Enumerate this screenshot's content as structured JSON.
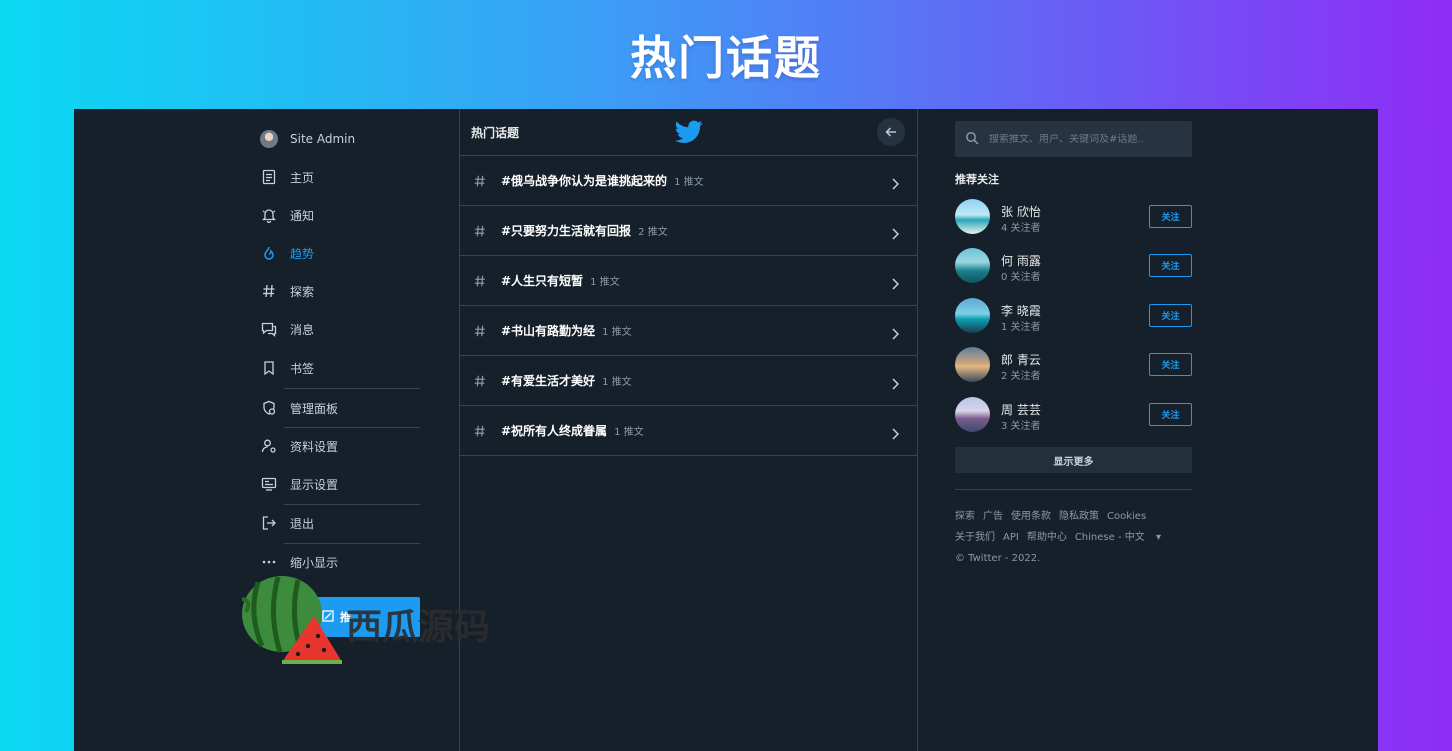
{
  "banner": {
    "title": "热门话题"
  },
  "nav": {
    "user": {
      "name": "Site Admin"
    },
    "items": [
      {
        "label": "主页",
        "icon": "home-icon"
      },
      {
        "label": "通知",
        "icon": "bell-icon"
      },
      {
        "label": "趋势",
        "icon": "flame-icon",
        "active": true
      },
      {
        "label": "探索",
        "icon": "hashtag-icon"
      },
      {
        "label": "消息",
        "icon": "messages-icon"
      },
      {
        "label": "书签",
        "icon": "bookmark-icon"
      },
      {
        "label": "管理面板",
        "icon": "admin-panel-icon"
      },
      {
        "label": "资料设置",
        "icon": "profile-settings-icon"
      },
      {
        "label": "显示设置",
        "icon": "display-settings-icon"
      },
      {
        "label": "退出",
        "icon": "logout-icon"
      },
      {
        "label": "缩小显示",
        "icon": "more-dots-icon"
      }
    ],
    "tweet_button": {
      "label": "推"
    }
  },
  "center": {
    "title": "热门话题",
    "topics": [
      {
        "name": "#俄乌战争你认为是谁挑起来的",
        "count": "1 推文"
      },
      {
        "name": "#只要努力生活就有回报",
        "count": "2 推文"
      },
      {
        "name": "#人生只有短暂",
        "count": "1 推文"
      },
      {
        "name": "#书山有路勤为经",
        "count": "1 推文"
      },
      {
        "name": "#有爱生活才美好",
        "count": "1 推文"
      },
      {
        "name": "#祝所有人终成眷属",
        "count": "1 推文"
      }
    ]
  },
  "right": {
    "search": {
      "placeholder": "搜索推文、用户、关键词及#话题.."
    },
    "suggest_title": "推荐关注",
    "users": [
      {
        "name": "张 欣怡",
        "followers": "4 关注者",
        "follow": "关注"
      },
      {
        "name": "何 雨露",
        "followers": "0 关注者",
        "follow": "关注"
      },
      {
        "name": "李 晓霞",
        "followers": "1 关注者",
        "follow": "关注"
      },
      {
        "name": "郎 青云",
        "followers": "2 关注者",
        "follow": "关注"
      },
      {
        "name": "周 芸芸",
        "followers": "3 关注者",
        "follow": "关注"
      }
    ],
    "show_more": "显示更多",
    "footer": {
      "links_row1": [
        "探索",
        "广告",
        "使用条款",
        "隐私政策",
        "Cookies"
      ],
      "links_row2": [
        "关于我们",
        "API",
        "帮助中心",
        "Chinese - 中文"
      ],
      "copyright": "© Twitter - 2022."
    }
  },
  "watermark": {
    "text": "西瓜源码"
  },
  "colors": {
    "accent": "#1d9bf0",
    "bg": "#15202b",
    "border": "#38444d"
  }
}
